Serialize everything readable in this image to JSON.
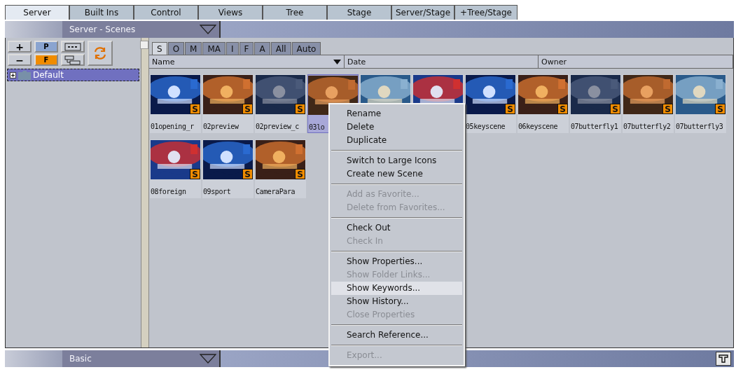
{
  "main_tabs": [
    {
      "label": "Server",
      "selected": true
    },
    {
      "label": "Built Ins",
      "selected": false
    },
    {
      "label": "Control",
      "selected": false
    },
    {
      "label": "Views",
      "selected": false
    },
    {
      "label": "Tree",
      "selected": false
    },
    {
      "label": "Stage",
      "selected": false
    },
    {
      "label": "Server/Stage",
      "selected": false
    },
    {
      "label": "+Tree/Stage",
      "selected": false
    }
  ],
  "panel_header": {
    "title": "Server - Scenes"
  },
  "toolbar": {
    "p_label": "P",
    "f_label": "F",
    "plus": "+",
    "minus": "−"
  },
  "tree": [
    {
      "label": "Default",
      "selected": true,
      "expanded": false
    }
  ],
  "filter_tabs": [
    {
      "label": "S",
      "selected": true
    },
    {
      "label": "O",
      "selected": false
    },
    {
      "label": "M",
      "selected": false
    },
    {
      "label": "MA",
      "selected": false
    },
    {
      "label": "I",
      "selected": false
    },
    {
      "label": "F",
      "selected": false
    },
    {
      "label": "A",
      "selected": false
    },
    {
      "label": "All",
      "selected": false
    },
    {
      "label": "Auto",
      "selected": false
    }
  ],
  "columns": [
    {
      "label": "Name",
      "sorted": true
    },
    {
      "label": "Date",
      "sorted": false
    },
    {
      "label": "Owner",
      "sorted": false
    }
  ],
  "scenes": [
    {
      "name": "01opening_r",
      "badge": "S",
      "selected": false
    },
    {
      "name": "02preview",
      "badge": "S",
      "selected": false
    },
    {
      "name": "02preview_c",
      "badge": "S",
      "selected": false
    },
    {
      "name": "03lo",
      "selected": true
    },
    {
      "selected": false
    },
    {
      "selected": false
    },
    {
      "name": "05keyscene",
      "badge": "S",
      "selected": false
    },
    {
      "name": "06keyscene",
      "badge": "S",
      "selected": false
    },
    {
      "name": "07butterfly1",
      "badge": "S",
      "selected": false
    },
    {
      "name": "07butterfly2",
      "badge": "S",
      "selected": false
    },
    {
      "name": "07butterfly3",
      "badge": "S",
      "selected": false
    },
    {
      "name": "08foreign",
      "badge": "S",
      "selected": false
    },
    {
      "name": "09sport",
      "badge": "S",
      "selected": false
    },
    {
      "name": "CameraPara",
      "badge": "S",
      "selected": false
    }
  ],
  "context_menu": [
    [
      {
        "label": "Rename",
        "disabled": false,
        "highlighted": false
      },
      {
        "label": "Delete",
        "disabled": false,
        "highlighted": false
      },
      {
        "label": "Duplicate",
        "disabled": false,
        "highlighted": false
      }
    ],
    [
      {
        "label": "Switch to Large Icons",
        "disabled": false,
        "highlighted": false
      },
      {
        "label": "Create new Scene",
        "disabled": false,
        "highlighted": false
      }
    ],
    [
      {
        "label": "Add as Favorite...",
        "disabled": true,
        "highlighted": false
      },
      {
        "label": "Delete from Favorites...",
        "disabled": true,
        "highlighted": false
      }
    ],
    [
      {
        "label": "Check Out",
        "disabled": false,
        "highlighted": false
      },
      {
        "label": "Check In",
        "disabled": true,
        "highlighted": false
      }
    ],
    [
      {
        "label": "Show Properties...",
        "disabled": false,
        "highlighted": false
      },
      {
        "label": "Show Folder Links...",
        "disabled": true,
        "highlighted": false
      },
      {
        "label": "Show Keywords...",
        "disabled": false,
        "highlighted": true
      },
      {
        "label": "Show History...",
        "disabled": false,
        "highlighted": false
      },
      {
        "label": "Close Properties",
        "disabled": true,
        "highlighted": false
      }
    ],
    [
      {
        "label": "Search Reference...",
        "disabled": false,
        "highlighted": false
      }
    ],
    [
      {
        "label": "Export...",
        "disabled": true,
        "highlighted": false
      }
    ]
  ],
  "bottom_header": {
    "title": "Basic"
  }
}
